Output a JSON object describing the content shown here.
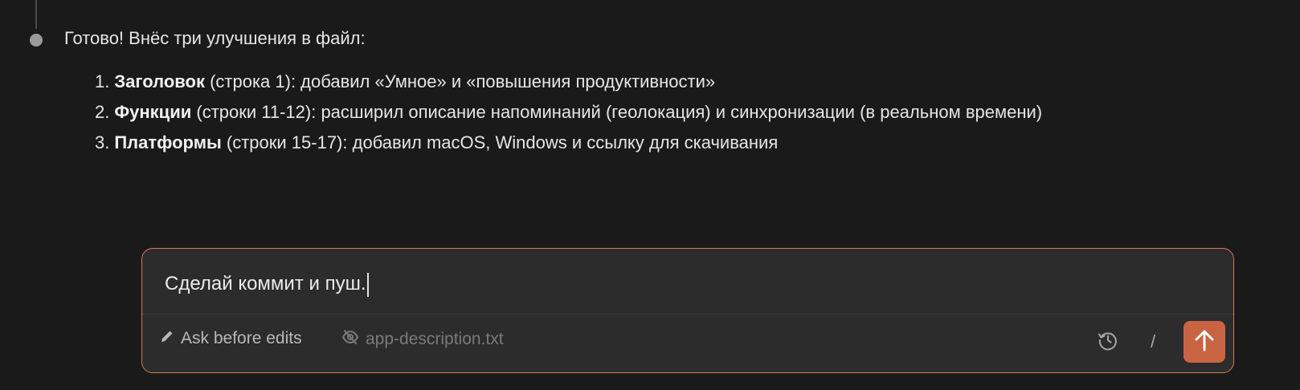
{
  "message": {
    "intro": "Готово! Внёс три улучшения в файл:",
    "items": [
      {
        "num": "1.",
        "title": "Заголовок",
        "text": " (строка 1): добавил «Умное» и «повышения продуктивности»"
      },
      {
        "num": "2.",
        "title": "Функции",
        "text": " (строки 11-12): расширил описание напоминаний (геолокация) и синхронизации (в реальном времени)"
      },
      {
        "num": "3.",
        "title": "Платформы",
        "text": " (строки 15-17): добавил macOS, Windows и ссылку для скачивания"
      }
    ]
  },
  "composer": {
    "input_value": "Сделай коммит и пуш.",
    "mode_label": "Ask before edits",
    "mode_icon": "pencil-icon",
    "file_label": "app-description.txt",
    "file_icon": "eye-off-icon",
    "history_icon": "history-icon",
    "slash_label": "/",
    "send_icon": "arrow-up-icon"
  },
  "colors": {
    "background": "#1a1a1a",
    "composer_bg": "#2c2c2c",
    "accent_border": "#d97757",
    "send_button": "#c96442"
  }
}
